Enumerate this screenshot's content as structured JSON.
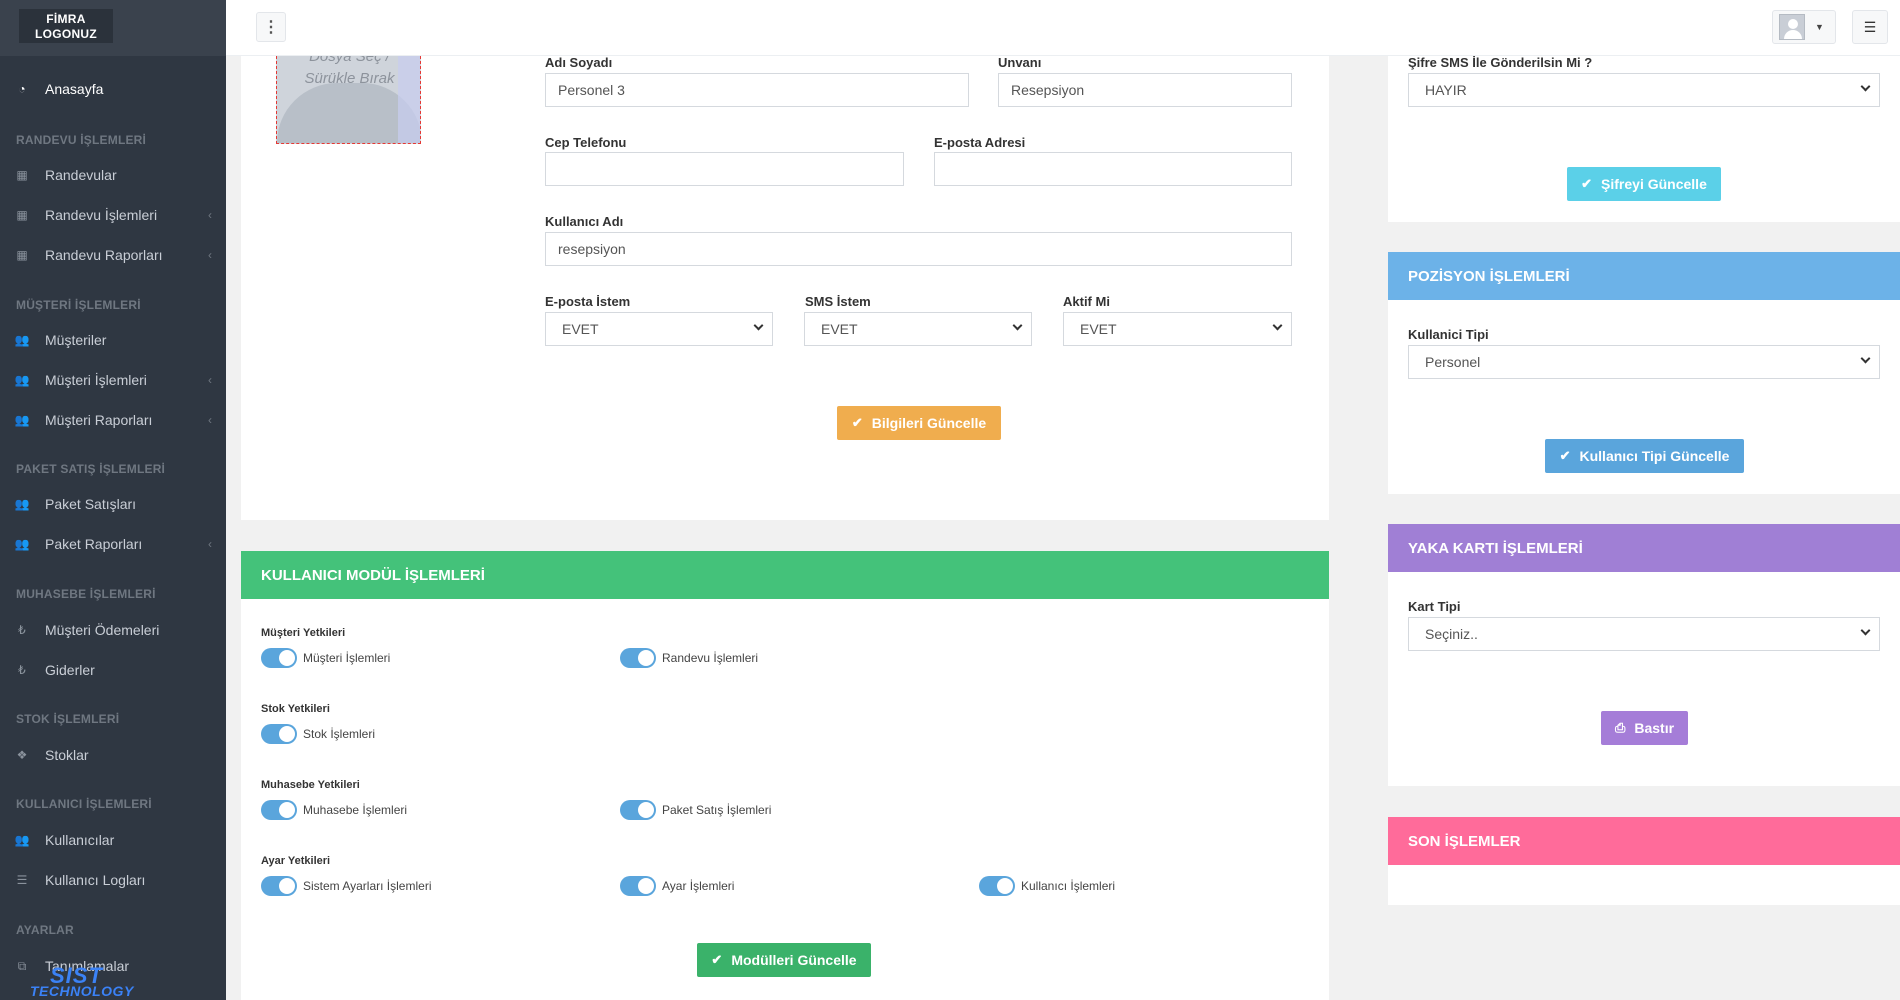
{
  "sidebar": {
    "logo_line1": "FİMRA",
    "logo_line2": "LOGONUZ",
    "home": "Anasayfa",
    "sections": {
      "randevu": "RANDEVU İŞLEMLERİ",
      "musteri": "MÜŞTERİ İŞLEMLERİ",
      "paket": "PAKET SATIŞ İŞLEMLERİ",
      "muhasebe": "MUHASEBE İŞLEMLERİ",
      "stok": "STOK İŞLEMLERİ",
      "kullanici": "KULLANICI İŞLEMLERİ",
      "ayarlar": "AYARLAR"
    },
    "items": {
      "randevular": "Randevular",
      "randevu_islemleri": "Randevu İşlemleri",
      "randevu_raporlari": "Randevu Raporları",
      "musteriler": "Müşteriler",
      "musteri_islemleri": "Müşteri İşlemleri",
      "musteri_raporlari": "Müşteri Raporları",
      "paket_satislari": "Paket Satışları",
      "paket_raporlari": "Paket Raporları",
      "musteri_odemeleri": "Müşteri Ödemeleri",
      "giderler": "Giderler",
      "stoklar": "Stoklar",
      "kullanicilar": "Kullanıcılar",
      "kullanici_loglari": "Kullanıcı Logları",
      "tanimlamalar": "Tanımlamalar"
    },
    "brand1": "SIST",
    "brand2": "TECHNOLOGY"
  },
  "photo": {
    "line1": "Dosya Seç /",
    "line2": "Sürükle Bırak"
  },
  "form": {
    "ad_soyadi_label": "Adı Soyadı",
    "ad_soyadi_value": "Personel 3",
    "unvani_label": "Unvanı",
    "unvani_value": "Resepsiyon",
    "cep_label": "Cep Telefonu",
    "cep_value": "",
    "eposta_label": "E-posta Adresi",
    "eposta_value": "",
    "kullanici_adi_label": "Kullanıcı Adı",
    "kullanici_adi_value": "resepsiyon",
    "eposta_istem_label": "E-posta İstem",
    "eposta_istem_value": "EVET",
    "sms_istem_label": "SMS İstem",
    "sms_istem_value": "EVET",
    "aktif_label": "Aktif Mi",
    "aktif_value": "EVET",
    "submit": "Bilgileri Güncelle"
  },
  "sifre": {
    "label": "Şifre SMS İle Gönderilsin Mi ?",
    "value": "HAYIR",
    "submit": "Şifreyi Güncelle"
  },
  "pozisyon": {
    "title": "POZİSYON İŞLEMLERİ",
    "label": "Kullanici Tipi",
    "value": "Personel",
    "submit": "Kullanıcı Tipi Güncelle"
  },
  "yaka": {
    "title": "YAKA KARTI İŞLEMLERİ",
    "label": "Kart Tipi",
    "value": "Seçiniz..",
    "submit": "Bastır"
  },
  "son": {
    "title": "SON İŞLEMLER"
  },
  "modul": {
    "title": "KULLANICI MODÜL İŞLEMLERİ",
    "groups": {
      "musteri": "Müşteri Yetkileri",
      "stok": "Stok Yetkileri",
      "muhasebe": "Muhasebe Yetkileri",
      "ayar": "Ayar Yetkileri"
    },
    "toggles": {
      "musteri_islemleri": "Müşteri İşlemleri",
      "randevu_islemleri": "Randevu İşlemleri",
      "stok_islemleri": "Stok İşlemleri",
      "muhasebe_islemleri": "Muhasebe İşlemleri",
      "paket_satis_islemleri": "Paket Satış İşlemleri",
      "sistem_ayarlari": "Sistem Ayarları İşlemleri",
      "ayar_islemleri": "Ayar İşlemleri",
      "kullanici_islemleri": "Kullanıcı İşlemleri"
    },
    "all_enabled": true,
    "submit": "Modülleri Güncelle"
  },
  "colors": {
    "sidebar": "#2f3742",
    "modul_header": "#44c27a",
    "pozisyon_header": "#6cb2e8",
    "yaka_header": "#a07fd5",
    "son_header": "#ff6b9a",
    "btn_orange": "#f0ad4e",
    "btn_cyan": "#5bd0e8",
    "btn_blue": "#5aa5dc",
    "btn_purple": "#a57dd8",
    "btn_green": "#3ab26a",
    "toggle_on": "#5aa5dc"
  }
}
